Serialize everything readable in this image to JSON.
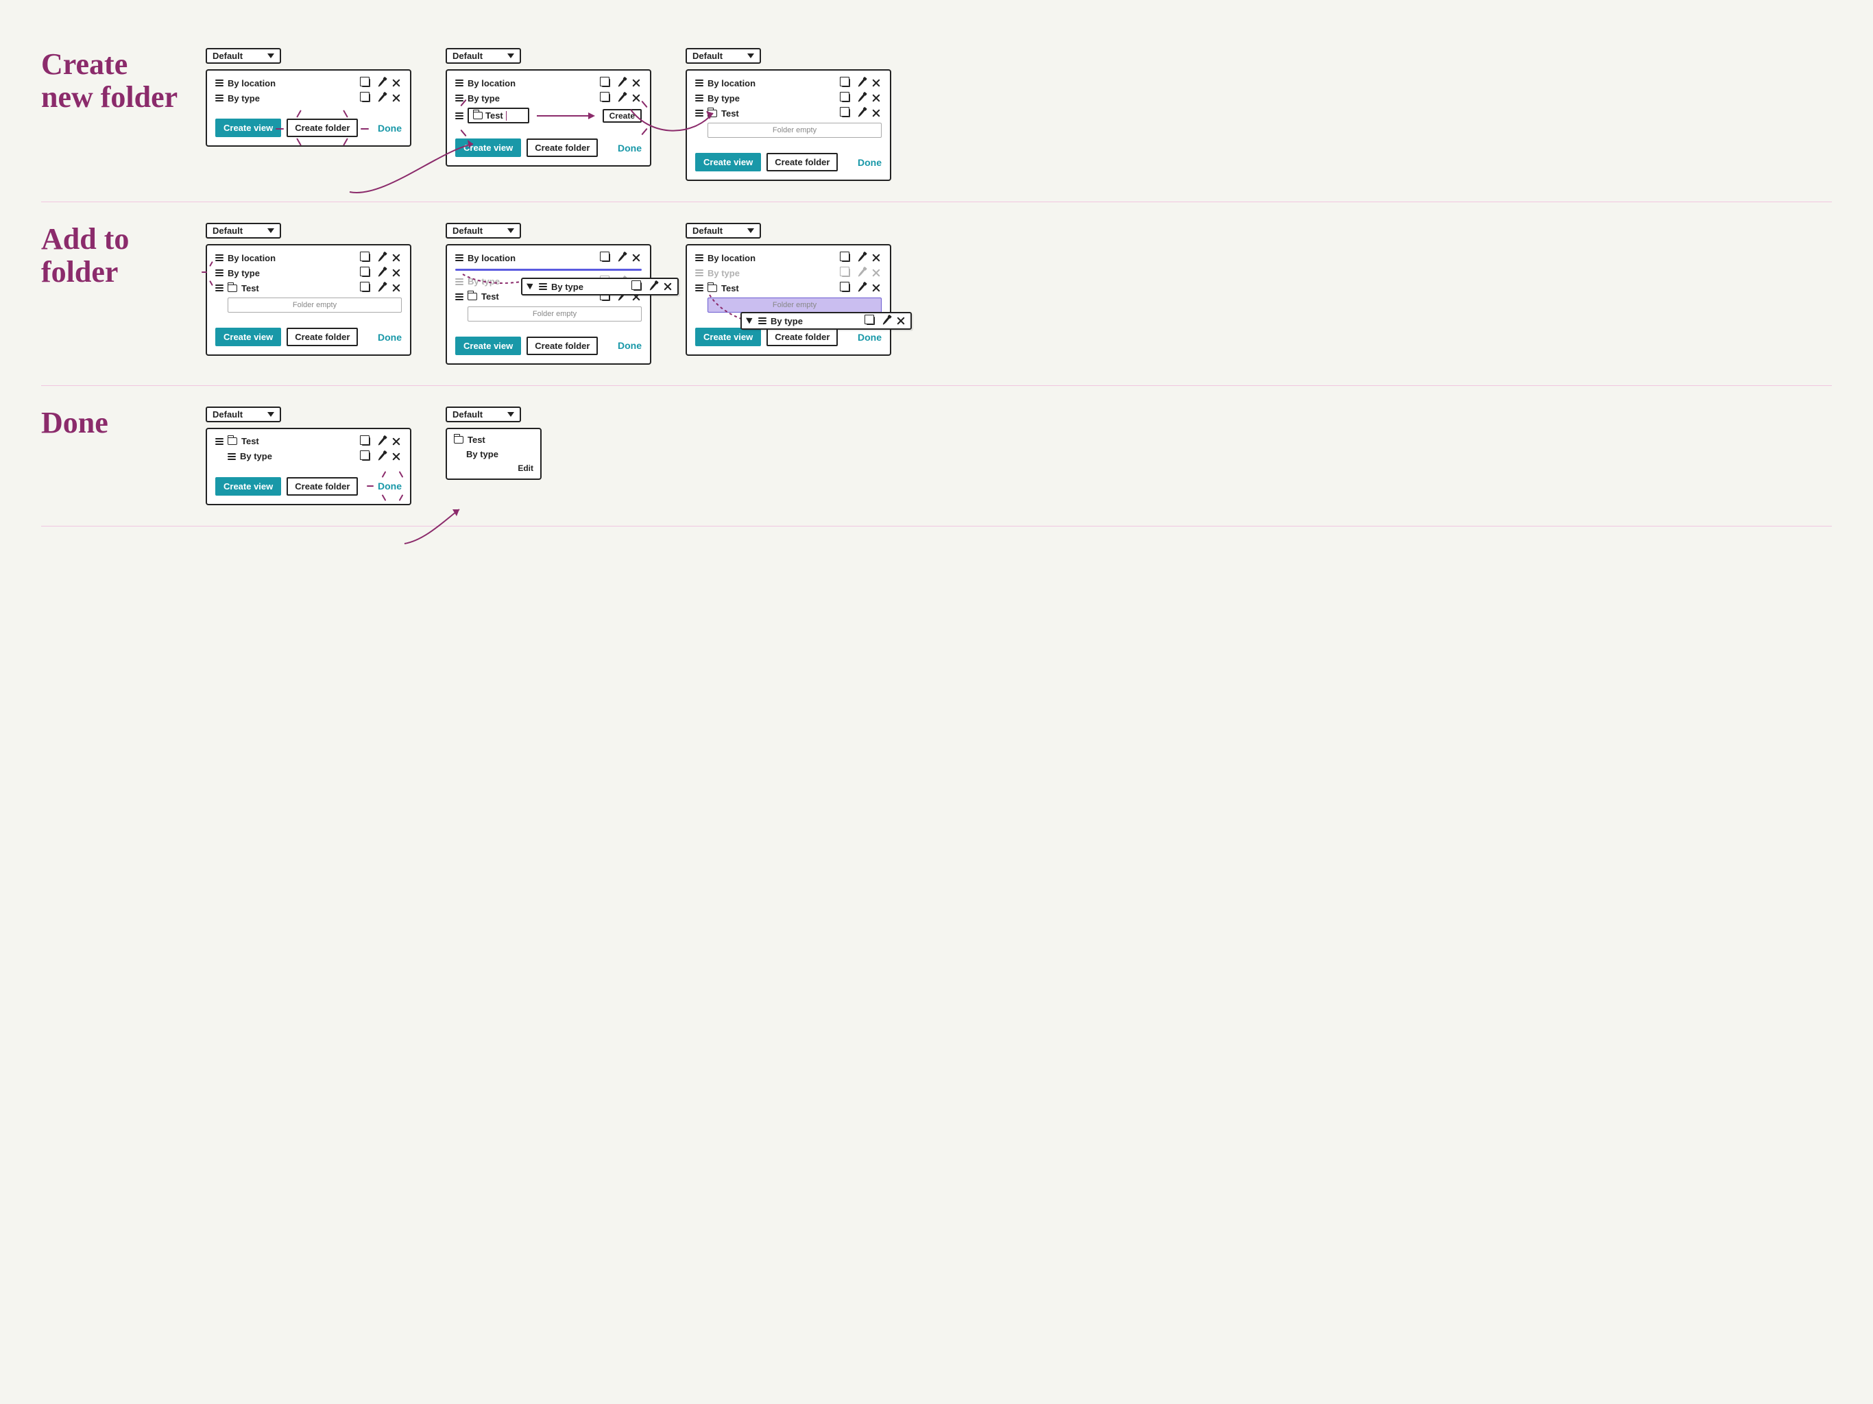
{
  "colors": {
    "accent": "#8b2b6b",
    "primary_btn": "#1998a8",
    "drop_indicator": "#5b5be0",
    "highlight_fill": "#cabef0"
  },
  "rows": [
    {
      "title": "Create new folder",
      "frames": [
        {
          "dropdown": "Default",
          "items": [
            {
              "drag": true,
              "label": "By location",
              "actions": [
                "copy",
                "edit",
                "delete"
              ]
            },
            {
              "drag": true,
              "label": "By type",
              "actions": [
                "copy",
                "edit",
                "delete"
              ]
            }
          ],
          "footer": {
            "primary": "Create view",
            "secondary": "Create folder",
            "done": "Done",
            "emphasize": "secondary"
          }
        },
        {
          "dropdown": "Default",
          "items": [
            {
              "drag": true,
              "label": "By location",
              "actions": [
                "copy",
                "edit",
                "delete"
              ]
            },
            {
              "drag": true,
              "label": "By type",
              "actions": [
                "copy",
                "edit",
                "delete"
              ]
            },
            {
              "drag": true,
              "input": {
                "value": "Test",
                "icon": "folder"
              },
              "create_btn": "Create",
              "emph_create": true
            }
          ],
          "footer": {
            "primary": "Create view",
            "secondary": "Create folder",
            "done": "Done"
          }
        },
        {
          "dropdown": "Default",
          "items": [
            {
              "drag": true,
              "label": "By location",
              "actions": [
                "copy",
                "edit",
                "delete"
              ]
            },
            {
              "drag": true,
              "label": "By type",
              "actions": [
                "copy",
                "edit",
                "delete"
              ]
            },
            {
              "drag": true,
              "folder": true,
              "label": "Test",
              "actions": [
                "copy",
                "edit",
                "delete"
              ]
            }
          ],
          "empty": "Folder empty",
          "footer": {
            "primary": "Create view",
            "secondary": "Create folder",
            "done": "Done"
          }
        }
      ]
    },
    {
      "title": "Add to folder",
      "frames": [
        {
          "dropdown": "Default",
          "items": [
            {
              "drag": true,
              "label": "By location",
              "actions": [
                "copy",
                "edit",
                "delete"
              ]
            },
            {
              "drag": true,
              "label": "By type",
              "actions": [
                "copy",
                "edit",
                "delete"
              ],
              "emph_drag": true
            },
            {
              "drag": true,
              "folder": true,
              "label": "Test",
              "actions": [
                "copy",
                "edit",
                "delete"
              ]
            }
          ],
          "empty": "Folder empty",
          "footer": {
            "primary": "Create view",
            "secondary": "Create folder",
            "done": "Done"
          }
        },
        {
          "dropdown": "Default",
          "items": [
            {
              "drag": true,
              "label": "By location",
              "actions": [
                "copy",
                "edit",
                "delete"
              ],
              "drop_line_after": true
            },
            {
              "drag": true,
              "label": "By type",
              "actions": [
                "copy",
                "edit",
                "delete"
              ],
              "faded": true
            },
            {
              "drag": true,
              "folder": true,
              "label": "Test",
              "actions": [
                "copy",
                "edit",
                "delete"
              ]
            }
          ],
          "empty": "Folder empty",
          "floating_item": {
            "label": "By type",
            "actions": [
              "copy",
              "edit",
              "delete"
            ],
            "pos": "right-mid"
          },
          "footer": {
            "primary": "Create view",
            "secondary": "Create folder",
            "done": "Done"
          }
        },
        {
          "dropdown": "Default",
          "items": [
            {
              "drag": true,
              "label": "By location",
              "actions": [
                "copy",
                "edit",
                "delete"
              ]
            },
            {
              "drag": true,
              "label": "By type",
              "actions": [
                "copy",
                "edit",
                "delete"
              ],
              "faded": true
            },
            {
              "drag": true,
              "folder": true,
              "label": "Test",
              "actions": [
                "copy",
                "edit",
                "delete"
              ]
            }
          ],
          "empty": "Folder empty",
          "empty_highlight": true,
          "floating_item": {
            "label": "By type",
            "actions": [
              "copy",
              "edit",
              "delete"
            ],
            "pos": "right-low"
          },
          "footer": {
            "primary": "Create view",
            "secondary": "Create folder",
            "done": "Done"
          }
        }
      ]
    },
    {
      "title": "Done",
      "frames": [
        {
          "dropdown": "Default",
          "items": [
            {
              "drag": true,
              "folder": true,
              "label": "Test",
              "actions": [
                "copy",
                "edit",
                "delete"
              ]
            },
            {
              "drag": true,
              "indent": true,
              "label": "By type",
              "actions": [
                "copy",
                "edit",
                "delete"
              ]
            }
          ],
          "footer": {
            "primary": "Create view",
            "secondary": "Create folder",
            "done": "Done",
            "emphasize": "done"
          }
        },
        {
          "dropdown": "Default",
          "small": true,
          "simple_items": [
            {
              "folder": true,
              "label": "Test"
            },
            {
              "indent": true,
              "label": "By type"
            }
          ],
          "edit_link": "Edit"
        }
      ]
    }
  ]
}
